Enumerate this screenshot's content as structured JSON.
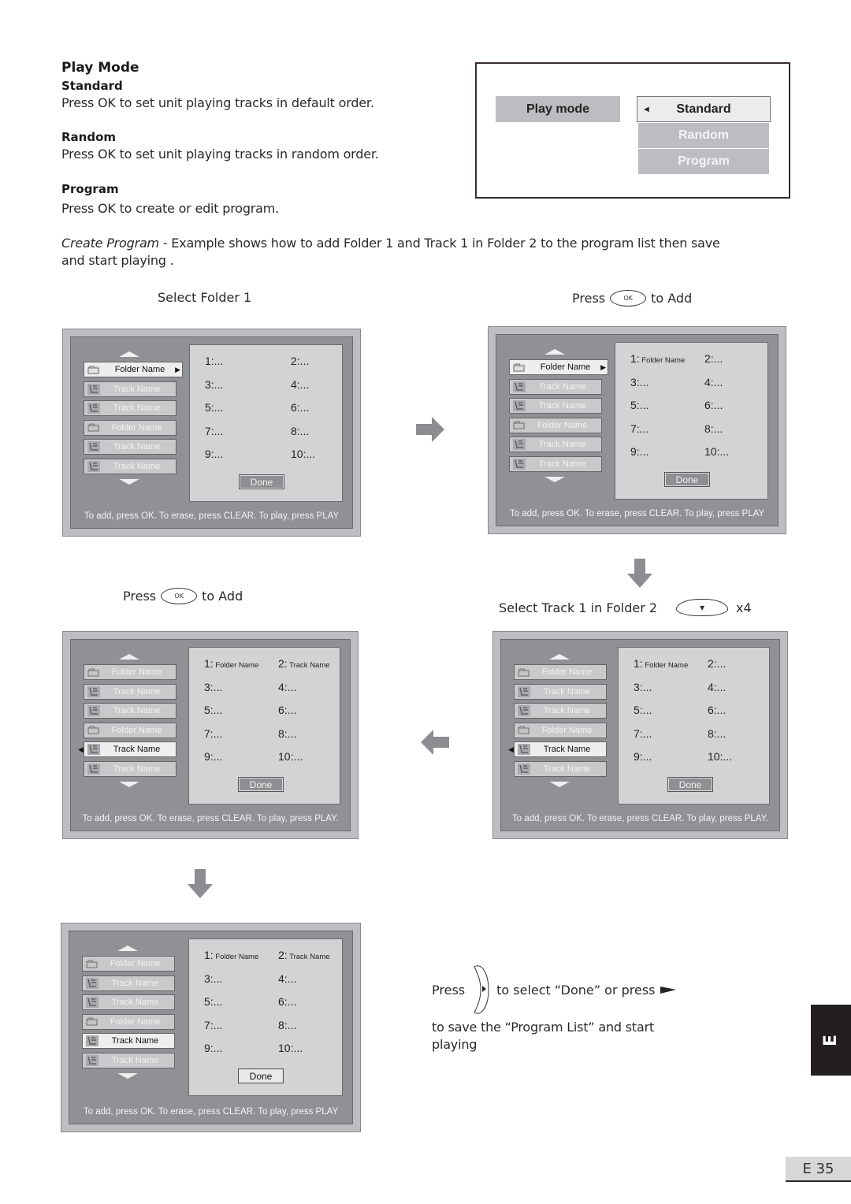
{
  "heading": {
    "title": "Play  Mode",
    "standard_label": "Standard",
    "standard_desc": "Press OK to set unit playing tracks in default order.",
    "random_label": "Random",
    "random_desc": "Press OK to set unit playing tracks in random order.",
    "program_label": "Program",
    "program_desc": "Press OK to create or edit program."
  },
  "intro": {
    "italic": "Create Program",
    "line1": " - Example shows how to add Folder 1 and Track 1 in Folder 2 to  the program list then save",
    "line2": "and start playing ."
  },
  "play_mode_menu": {
    "label": "Play mode",
    "options": [
      "Standard",
      "Random",
      "Program"
    ],
    "selected": "Standard",
    "arrow": "◄"
  },
  "captions": {
    "step1": "Select Folder 1",
    "press": "Press",
    "to_add": "to Add",
    "ok": "OK",
    "select_track": "Select Track 1 in Folder 2",
    "times": "x4",
    "final_press": "Press",
    "final_mid": "to select “Done” or press",
    "final_line2": "to save the “Program List” and start",
    "final_line3": "playing"
  },
  "screens": [
    {
      "items": [
        {
          "type": "folder",
          "label": "Folder Name",
          "active": true,
          "arrow": "right"
        },
        {
          "type": "track",
          "label": "Track Name"
        },
        {
          "type": "track",
          "label": "Track Name"
        },
        {
          "type": "folder",
          "label": "Folder Name"
        },
        {
          "type": "track",
          "label": "Track Name"
        },
        {
          "type": "track",
          "label": "Track Name"
        }
      ],
      "slots": [
        "1:...",
        "2:...",
        "3:...",
        "4:...",
        "5:...",
        "6:...",
        "7:...",
        "8:...",
        "9:...",
        "10:..."
      ],
      "done": "Done",
      "hint": "To add, press OK. To erase, press CLEAR. To play, press PLAY"
    },
    {
      "items": [
        {
          "type": "folder",
          "label": "Folder Name",
          "active": true,
          "arrow": "right"
        },
        {
          "type": "track",
          "label": "Track Name"
        },
        {
          "type": "track",
          "label": "Track Name"
        },
        {
          "type": "folder",
          "label": "Folder Name"
        },
        {
          "type": "track",
          "label": "Track Name"
        },
        {
          "type": "track",
          "label": "Track Name"
        }
      ],
      "slots": [
        "1:",
        "2:...",
        "3:...",
        "4:...",
        "5:...",
        "6:...",
        "7:...",
        "8:...",
        "9:...",
        "10:..."
      ],
      "slot_names": {
        "0": "Folder Name"
      },
      "done": "Done",
      "hint": "To add, press OK. To erase, press CLEAR. To play, press PLAY"
    },
    {
      "items": [
        {
          "type": "folder",
          "label": "Folder Name"
        },
        {
          "type": "track",
          "label": "Track Name"
        },
        {
          "type": "track",
          "label": "Track Name"
        },
        {
          "type": "folder",
          "label": "Folder Name"
        },
        {
          "type": "track",
          "label": "Track Name",
          "active": true,
          "arrow": "left"
        },
        {
          "type": "track",
          "label": "Track Name"
        }
      ],
      "slots": [
        "1:",
        "2:",
        "3:...",
        "4:...",
        "5:...",
        "6:...",
        "7:...",
        "8:...",
        "9:...",
        "10:..."
      ],
      "slot_names": {
        "0": "Folder Name",
        "1": "Track Name"
      },
      "done": "Done",
      "hint": "To add, press OK. To erase, press CLEAR. To play, press PLAY."
    },
    {
      "items": [
        {
          "type": "folder",
          "label": "Folder Name"
        },
        {
          "type": "track",
          "label": "Track Name"
        },
        {
          "type": "track",
          "label": "Track Name"
        },
        {
          "type": "folder",
          "label": "Folder Name"
        },
        {
          "type": "track",
          "label": "Track Name",
          "active": true,
          "arrow": "left"
        },
        {
          "type": "track",
          "label": "Track Name"
        }
      ],
      "slots": [
        "1:",
        "2:...",
        "3:...",
        "4:...",
        "5:...",
        "6:...",
        "7:...",
        "8:...",
        "9:...",
        "10:..."
      ],
      "slot_names": {
        "0": "Folder Name"
      },
      "done": "Done",
      "hint": "To add, press OK. To erase, press CLEAR. To play, press PLAY."
    },
    {
      "items": [
        {
          "type": "folder",
          "label": "Folder Name"
        },
        {
          "type": "track",
          "label": "Track Name"
        },
        {
          "type": "track",
          "label": "Track Name"
        },
        {
          "type": "folder",
          "label": "Folder Name"
        },
        {
          "type": "track",
          "label": "Track Name",
          "active": true
        },
        {
          "type": "track",
          "label": "Track Name"
        }
      ],
      "slots": [
        "1:",
        "2:",
        "3:...",
        "4:...",
        "5:...",
        "6:...",
        "7:...",
        "8:...",
        "9:...",
        "10:..."
      ],
      "slot_names": {
        "0": "Folder Name",
        "1": "Track Name"
      },
      "done": "Done",
      "done_active": true,
      "hint": "To add, press OK. To erase, press CLEAR. To play, press PLAY"
    }
  ],
  "side_tab": "E",
  "page_number": "E 35"
}
